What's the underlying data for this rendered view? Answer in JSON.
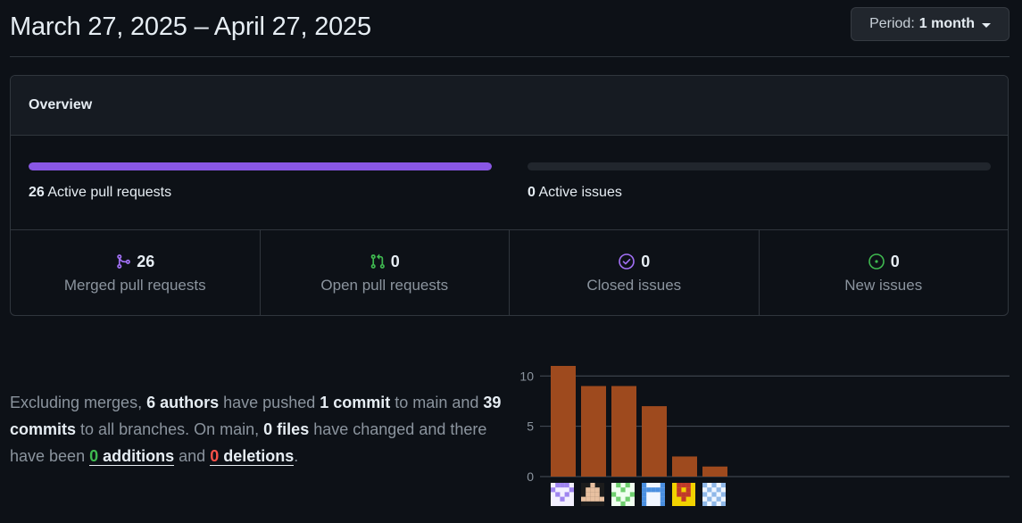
{
  "header": {
    "date_range": "March 27, 2025 – April 27, 2025",
    "period_label": "Period:",
    "period_value": "1 month"
  },
  "overview": {
    "title": "Overview",
    "active_prs": {
      "count": "26",
      "label": "Active pull requests",
      "fill_fraction": 1.0,
      "color": "#8957e5"
    },
    "active_issues": {
      "count": "0",
      "label": "Active issues",
      "fill_fraction": 0.0
    },
    "stats": [
      {
        "id": "merged-prs",
        "icon": "git-merge-icon",
        "count": "26",
        "label": "Merged pull requests",
        "color": "#a371f7"
      },
      {
        "id": "open-prs",
        "icon": "git-pull-request-icon",
        "count": "0",
        "label": "Open pull requests",
        "color": "#3fb950"
      },
      {
        "id": "closed-issues",
        "icon": "issue-closed-icon",
        "count": "0",
        "label": "Closed issues",
        "color": "#a371f7"
      },
      {
        "id": "new-issues",
        "icon": "issue-opened-icon",
        "count": "0",
        "label": "New issues",
        "color": "#3fb950"
      }
    ]
  },
  "summary": {
    "t1": "Excluding merges,",
    "authors": "6 authors",
    "t2": "have pushed",
    "commit_main": "1 commit",
    "t3": "to main and",
    "commits_all": "39 commits",
    "t4": "to all branches. On main,",
    "files": "0 files",
    "t5": "have changed and there have been",
    "additions_num": "0",
    "additions_word": "additions",
    "t6": "and",
    "deletions_num": "0",
    "deletions_word": "deletions",
    "t7": "."
  },
  "chart_data": {
    "type": "bar",
    "categories": [
      "author-1",
      "author-2",
      "author-3",
      "author-4",
      "author-5",
      "author-6"
    ],
    "values": [
      11,
      9,
      9,
      7,
      2,
      1
    ],
    "ylim": [
      0,
      11
    ],
    "yticks": [
      0,
      5,
      10
    ],
    "grid": true,
    "bar_color": "#9e4a1e",
    "title": "",
    "xlabel": "",
    "ylabel": ""
  }
}
